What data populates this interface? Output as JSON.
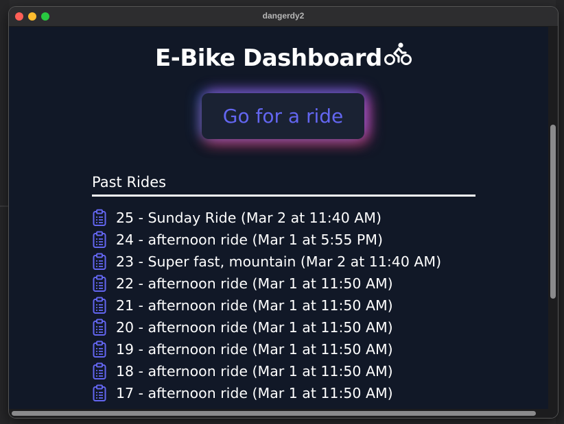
{
  "window": {
    "title": "dangerdy2"
  },
  "app": {
    "title": "E-Bike Dashboard",
    "title_icon": "bicycle-icon",
    "ride_button_label": "Go for a ride"
  },
  "past_rides": {
    "heading": "Past Rides",
    "item_icon": "clipboard-icon",
    "items": [
      {
        "label": "25 - Sunday Ride (Mar 2 at 11:40 AM)"
      },
      {
        "label": "24 - afternoon ride (Mar 1 at 5:55 PM)"
      },
      {
        "label": "23 - Super fast, mountain (Mar 2 at 11:40 AM)"
      },
      {
        "label": "22 - afternoon ride (Mar 1 at 11:50 AM)"
      },
      {
        "label": "21 - afternoon ride (Mar 1 at 11:50 AM)"
      },
      {
        "label": "20 - afternoon ride (Mar 1 at 11:50 AM)"
      },
      {
        "label": "19 - afternoon ride (Mar 1 at 11:50 AM)"
      },
      {
        "label": "18 - afternoon ride (Mar 1 at 11:50 AM)"
      },
      {
        "label": "17 - afternoon ride (Mar 1 at 11:50 AM)"
      }
    ]
  },
  "colors": {
    "background": "#111827",
    "accent": "#6366f1",
    "text": "#ffffff"
  }
}
